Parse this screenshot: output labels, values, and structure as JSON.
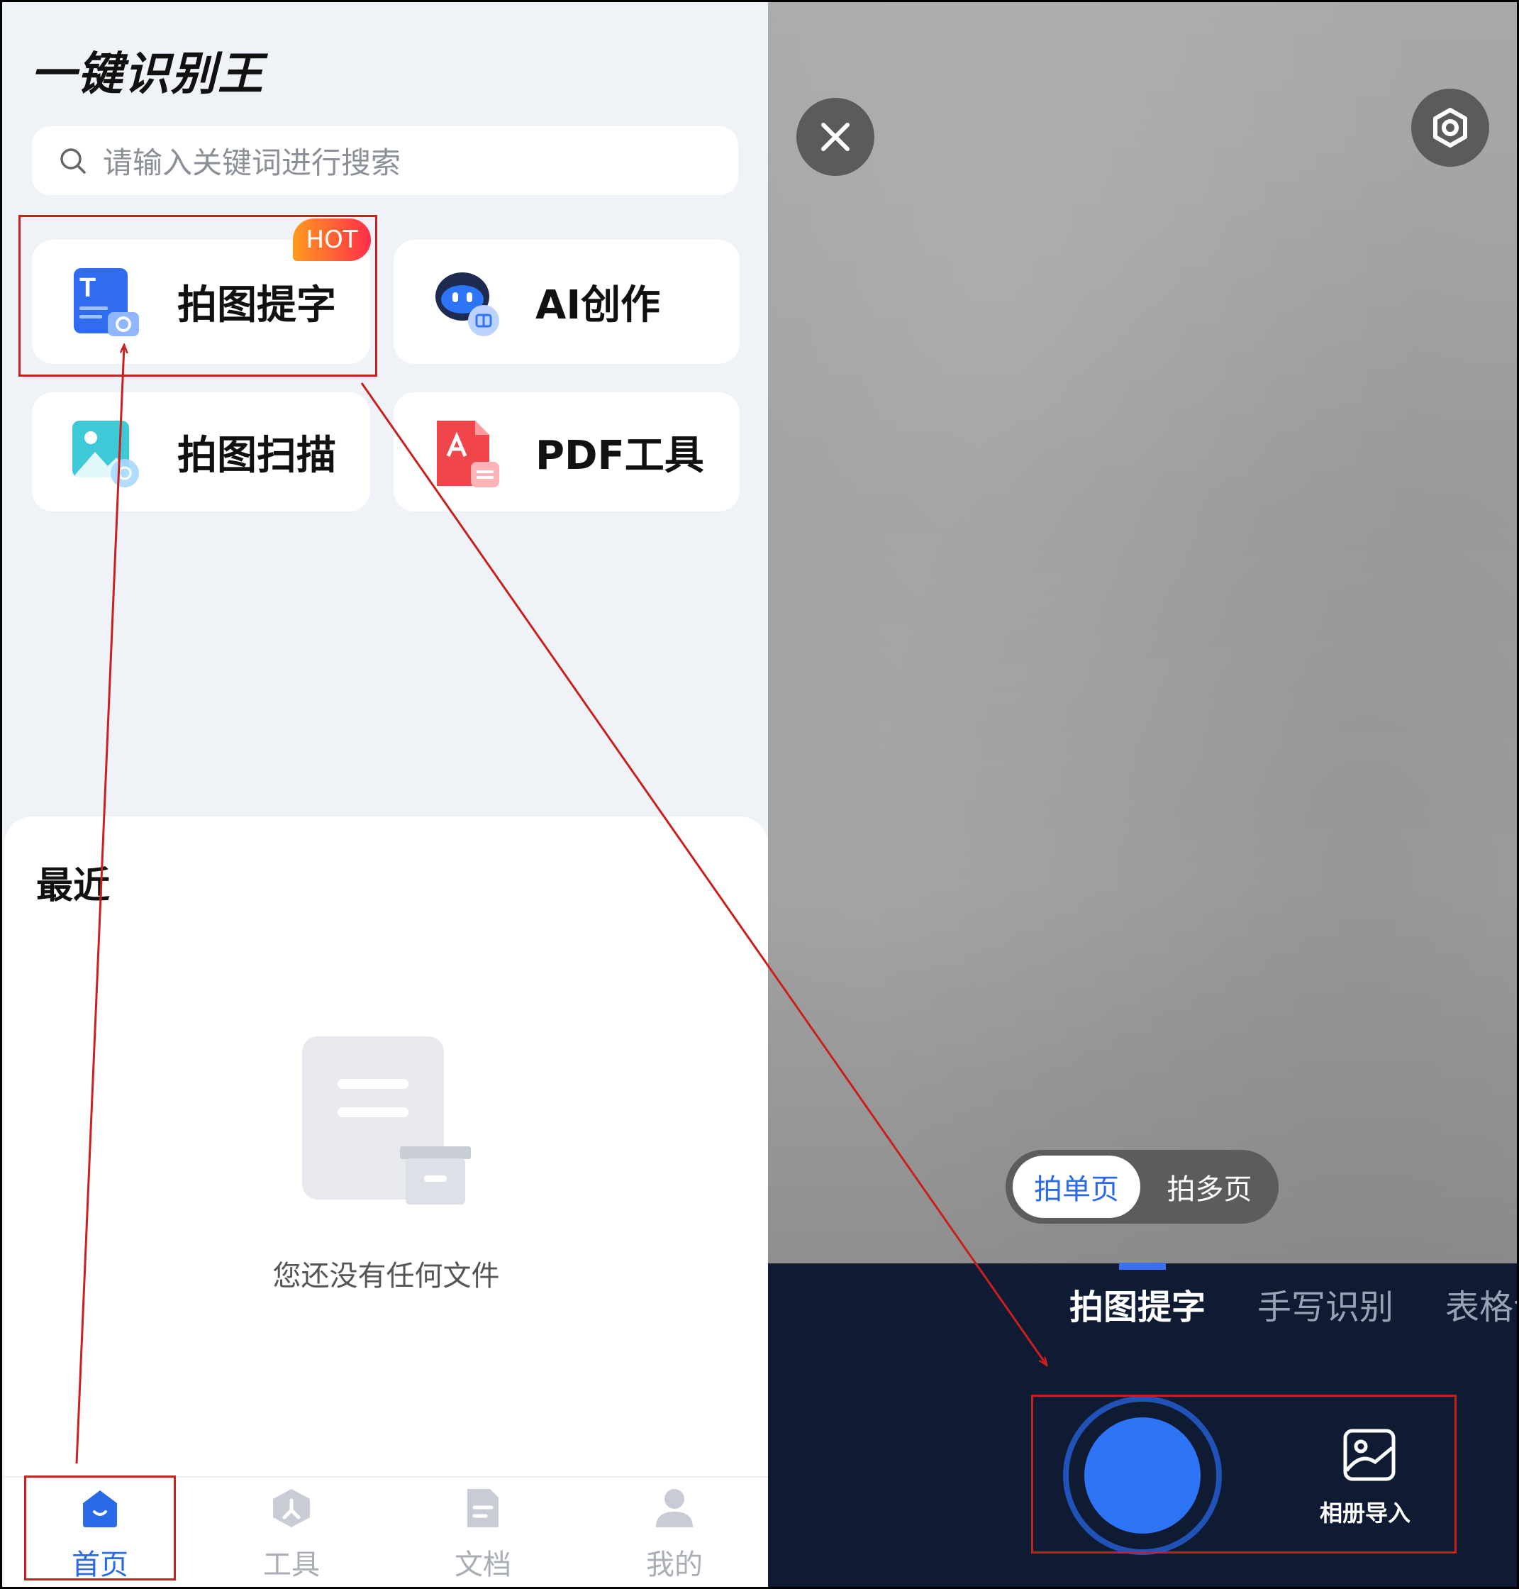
{
  "home": {
    "app_title": "一键识别王",
    "search_placeholder": "请输入关键词进行搜索",
    "features": [
      {
        "label": "拍图提字",
        "badge": "HOT"
      },
      {
        "label": "AI创作"
      },
      {
        "label": "拍图扫描"
      },
      {
        "label": "PDF工具"
      }
    ],
    "recent_title": "最近",
    "empty_text": "您还没有任何文件",
    "tabs": [
      {
        "label": "首页",
        "active": true
      },
      {
        "label": "工具"
      },
      {
        "label": "文档"
      },
      {
        "label": "我的"
      }
    ]
  },
  "camera": {
    "capture_modes": [
      "拍单页",
      "拍多页"
    ],
    "selected_capture_mode": "拍单页",
    "modes": [
      "拍图提字",
      "手写识别",
      "表格识"
    ],
    "selected_mode": "拍图提字",
    "album_label": "相册导入"
  },
  "colors": {
    "accent": "#2a6ae6",
    "annotation": "#c8201c",
    "camera_bg": "#0f1a33",
    "shutter": "#2e74f7"
  }
}
